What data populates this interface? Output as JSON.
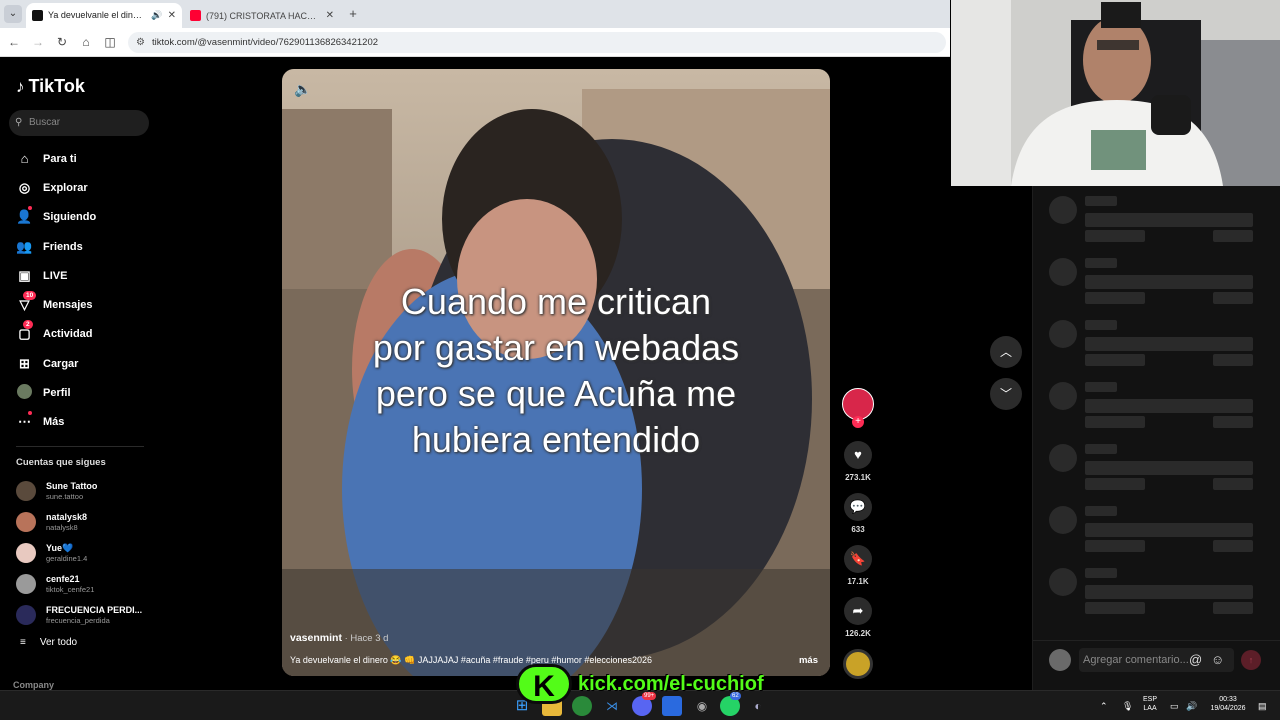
{
  "browser": {
    "tabs": [
      {
        "title": "Ya devuelvanle el dinero 😂 🤫 ...",
        "active": true
      },
      {
        "title": "(791) CRISTORATA HACE COMP...",
        "active": false
      }
    ],
    "url": "tiktok.com/@vasenmint/video/7629011368263421202"
  },
  "sidebar": {
    "brand": "TikTok",
    "search_placeholder": "Buscar",
    "nav": [
      {
        "label": "Para ti",
        "icon": "home-icon"
      },
      {
        "label": "Explorar",
        "icon": "compass-icon"
      },
      {
        "label": "Siguiendo",
        "icon": "following-icon"
      },
      {
        "label": "Friends",
        "icon": "friends-icon"
      },
      {
        "label": "LIVE",
        "icon": "live-icon"
      },
      {
        "label": "Mensajes",
        "icon": "messages-icon",
        "badge": "10"
      },
      {
        "label": "Actividad",
        "icon": "activity-icon",
        "badge": "2"
      },
      {
        "label": "Cargar",
        "icon": "upload-icon"
      },
      {
        "label": "Perfil",
        "icon": "profile-icon"
      },
      {
        "label": "Más",
        "icon": "more-icon"
      }
    ],
    "following_title": "Cuentas que sigues",
    "following": [
      {
        "name": "Sune Tattoo",
        "handle": "sune.tattoo"
      },
      {
        "name": "natalysk8",
        "handle": "natalysk8"
      },
      {
        "name": "Yue💙",
        "handle": "geraldine1.4"
      },
      {
        "name": "cenfe21",
        "handle": "tiktok_cenfe21"
      },
      {
        "name": "FRECUENCIA PERDI...",
        "handle": "frecuencia_perdida"
      }
    ],
    "see_all": "Ver todo",
    "company": "Company"
  },
  "video": {
    "overlay_text": [
      "Cuando me critican",
      "por gastar en webadas",
      "pero se que Acuña me",
      "hubiera entendido"
    ],
    "author": "vasenmint",
    "posted": " · Hace 3 d",
    "description": "Ya devuelvanle el dinero 😂 👊 JAJJAJAJ #acuña #fraude #peru #humor #elecciones2026",
    "more": "más"
  },
  "actions": {
    "likes": "273.1K",
    "comments": "633",
    "saves": "17.1K",
    "shares": "126.2K"
  },
  "comments_panel": {
    "input_placeholder": "Agregar comentario..."
  },
  "overlay": {
    "kick_logo": "K",
    "kick_url": "kick.com/el-cuchiof"
  },
  "taskbar": {
    "lang_top": "ESP",
    "lang_bottom": "LAA",
    "time": "00:33",
    "date": "19/04/2026",
    "discord_badge": "99+",
    "whatsapp_badge": "62"
  },
  "colors": {
    "tiktok_red": "#fe2c55",
    "kick_green": "#53fc18",
    "background": "#000000",
    "panel": "#121212"
  }
}
